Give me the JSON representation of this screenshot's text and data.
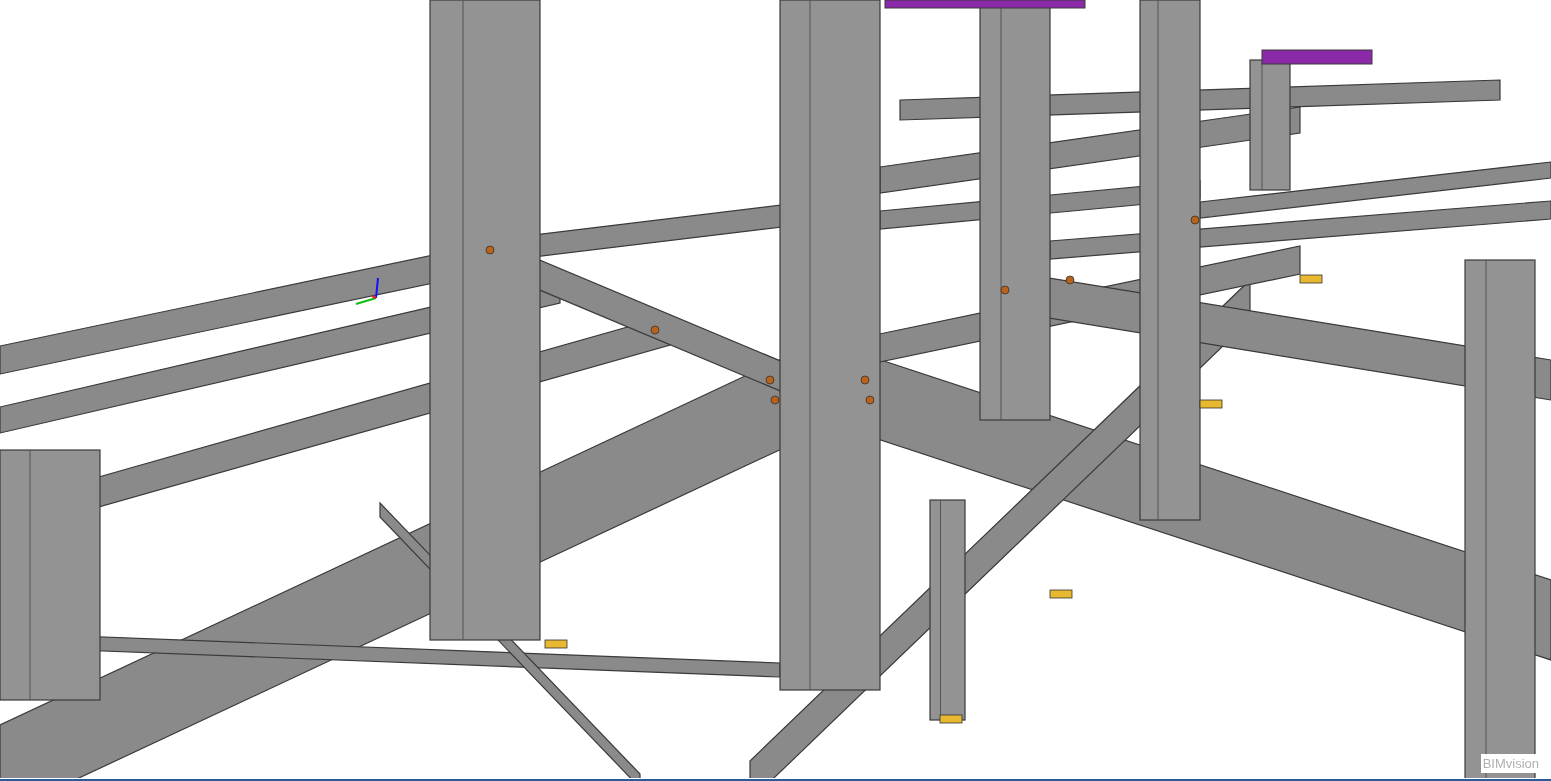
{
  "viewport": {
    "logo": "BIMvision"
  }
}
